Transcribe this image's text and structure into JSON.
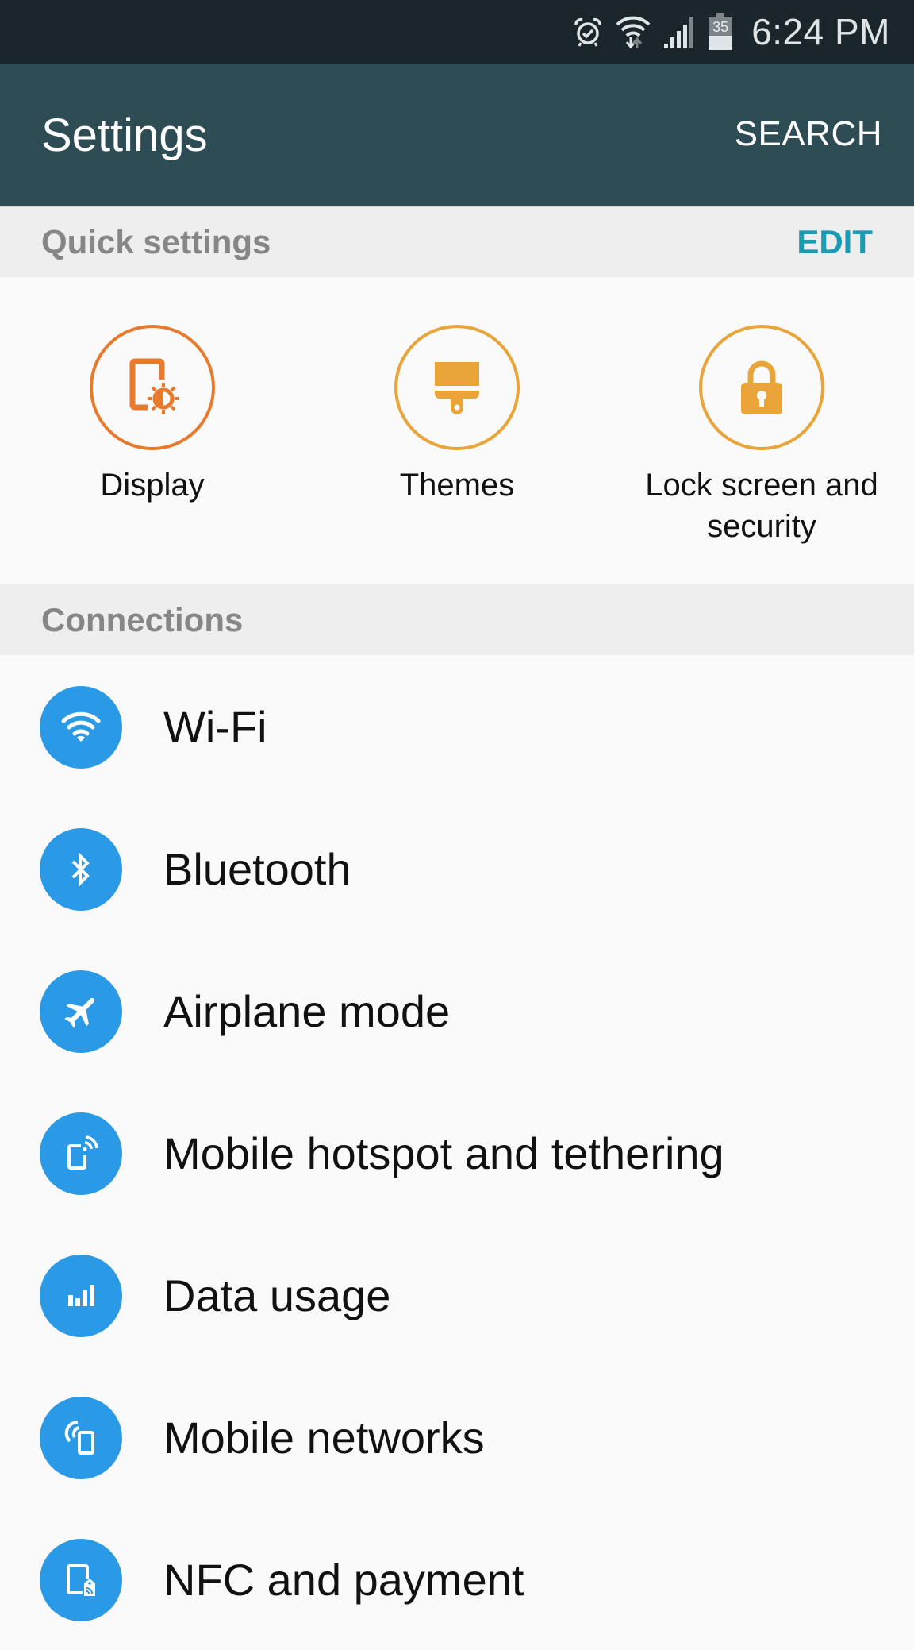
{
  "status_bar": {
    "icons": [
      "alarm-icon",
      "wifi-data-icon",
      "signal-icon",
      "battery-icon"
    ],
    "battery_level": "35",
    "time": "6:24 PM"
  },
  "app_bar": {
    "title": "Settings",
    "search_label": "SEARCH"
  },
  "quick_settings": {
    "header": "Quick settings",
    "edit_label": "EDIT",
    "items": [
      {
        "label": "Display",
        "icon": "display-icon",
        "color": "#e87a2e"
      },
      {
        "label": "Themes",
        "icon": "paintbrush-icon",
        "color": "#eaa53a"
      },
      {
        "label": "Lock screen and security",
        "icon": "lock-icon",
        "color": "#eaa53a"
      }
    ]
  },
  "connections": {
    "header": "Connections",
    "icon_color": "#2b9ae6",
    "items": [
      {
        "label": "Wi-Fi",
        "icon": "wifi-icon"
      },
      {
        "label": "Bluetooth",
        "icon": "bluetooth-icon"
      },
      {
        "label": "Airplane mode",
        "icon": "airplane-icon"
      },
      {
        "label": "Mobile hotspot and tethering",
        "icon": "hotspot-icon"
      },
      {
        "label": "Data usage",
        "icon": "data-usage-icon"
      },
      {
        "label": "Mobile networks",
        "icon": "mobile-networks-icon"
      },
      {
        "label": "NFC and payment",
        "icon": "nfc-payment-icon"
      }
    ]
  },
  "colors": {
    "status_bar_bg": "#1b262c",
    "app_bar_bg": "#2e4c53",
    "section_header_bg": "#eeeeee",
    "accent": "#1a9bb3",
    "list_icon_bg": "#2b9ae6"
  }
}
